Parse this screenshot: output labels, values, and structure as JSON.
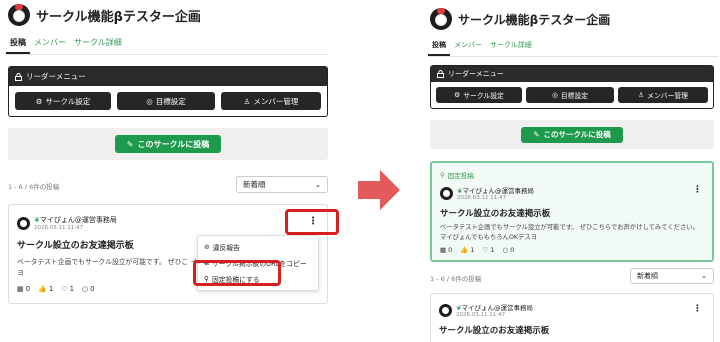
{
  "circle": {
    "title": "サークル機能βテスター企画"
  },
  "tabs": [
    {
      "label": "投稿"
    },
    {
      "label": "メンバー"
    },
    {
      "label": "サークル詳細"
    }
  ],
  "leader_menu": {
    "title": "リーダーメニュー",
    "buttons": [
      {
        "label": "サークル設定",
        "icon": "gear-icon"
      },
      {
        "label": "目標設定",
        "icon": "target-icon"
      },
      {
        "label": "メンバー管理",
        "icon": "user-gear-icon"
      }
    ]
  },
  "post_button": {
    "label": "このサークルに投稿",
    "icon": "pencil-icon"
  },
  "list": {
    "count_left": "1 - 6 / 6件の投稿",
    "count_right": "1 - 6 / 6件の投稿",
    "sort": "新着順"
  },
  "post": {
    "author": "マイぴょん@運営事務局",
    "date": "2026.03.11 11:47",
    "title": "サークル設立のお友達掲示板",
    "body_left": "ベータテスト企画でもサークル設立が可能です。 ぜひこ イぴょんでももちろんOKデスヨ",
    "body_right": "ベータテスト企画でもサークル設立が可能です。 ぜひこちらでお声がけしてみてください。 マイぴょんでももちろんOKデスヨ",
    "stats": {
      "views": "0",
      "likes": "1",
      "hearts": "1",
      "comments": "0"
    }
  },
  "pinned_label": "固定投稿",
  "menu_items": [
    {
      "label": "違反報告",
      "icon": "ban-icon"
    },
    {
      "label": "サークル掲示板のURLをコピー",
      "icon": "copy-icon"
    },
    {
      "label": "固定投稿にする",
      "icon": "pin-icon"
    }
  ],
  "colors": {
    "accent": "#1f9a4d",
    "highlight": "#d81f1f",
    "arrow": "#e35a5a",
    "pinned_border": "#7cc79a"
  }
}
